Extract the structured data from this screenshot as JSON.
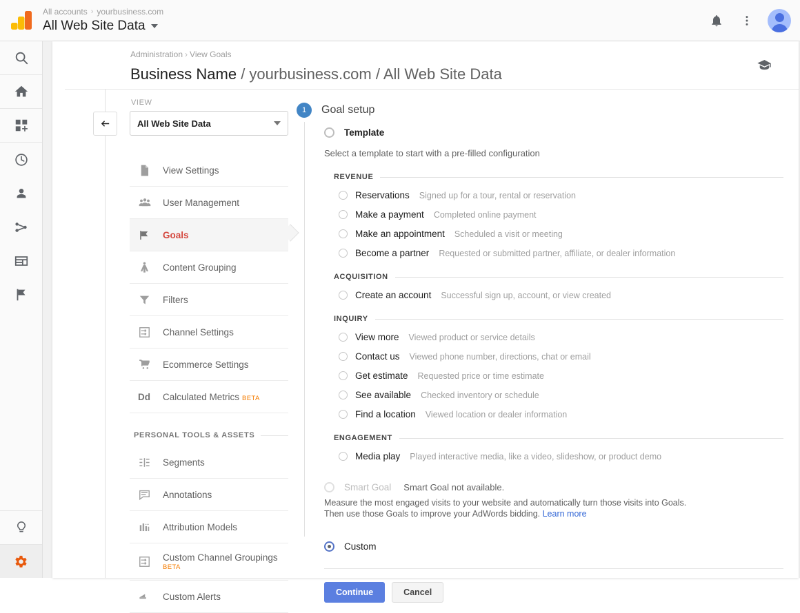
{
  "topbar": {
    "logo_icon": "google-analytics-logo",
    "breadcrumb": {
      "all_accounts": "All accounts",
      "separator": "›",
      "account": "yourbusiness.com"
    },
    "view_title": "All Web Site Data",
    "notifications_icon": "bell-icon",
    "more_icon": "more-vertical-icon",
    "avatar_icon": "user-avatar"
  },
  "rail": {
    "items": [
      {
        "name": "search-icon",
        "label": "Search"
      },
      {
        "name": "home-icon",
        "label": "Home"
      },
      {
        "name": "customization-icon",
        "label": "Customization"
      },
      {
        "name": "realtime-clock-icon",
        "label": "Realtime"
      },
      {
        "name": "audience-person-icon",
        "label": "Audience"
      },
      {
        "name": "acquisition-share-icon",
        "label": "Acquisition"
      },
      {
        "name": "behavior-window-icon",
        "label": "Behavior"
      },
      {
        "name": "conversions-flag-icon",
        "label": "Conversions"
      }
    ],
    "bottom_items": [
      {
        "name": "discover-bulb-icon",
        "label": "Discover"
      },
      {
        "name": "admin-gear-icon",
        "label": "Admin"
      }
    ]
  },
  "panel": {
    "breadcrumb": {
      "administration": "Administration",
      "separator": "›",
      "current": "View Goals"
    },
    "title_strong": "Business Name",
    "title_rest": " / yourbusiness.com / All Web Site Data",
    "academy_icon": "graduation-cap-icon"
  },
  "view_nav": {
    "collapse_icon": "arrow-left-icon",
    "view_label": "VIEW",
    "view_selected": "All Web Site Data",
    "items": [
      {
        "label": "View Settings",
        "icon": "document-icon",
        "active": false,
        "beta": ""
      },
      {
        "label": "User Management",
        "icon": "people-icon",
        "active": false,
        "beta": ""
      },
      {
        "label": "Goals",
        "icon": "flag-icon",
        "active": true,
        "beta": ""
      },
      {
        "label": "Content Grouping",
        "icon": "content-grouping-icon",
        "active": false,
        "beta": ""
      },
      {
        "label": "Filters",
        "icon": "filter-funnel-icon",
        "active": false,
        "beta": ""
      },
      {
        "label": "Channel Settings",
        "icon": "channel-settings-icon",
        "active": false,
        "beta": ""
      },
      {
        "label": "Ecommerce Settings",
        "icon": "shopping-cart-icon",
        "active": false,
        "beta": ""
      },
      {
        "label": "Calculated Metrics",
        "icon": "dd-icon",
        "active": false,
        "beta": "BETA"
      }
    ],
    "personal_section_title": "PERSONAL TOOLS & ASSETS",
    "personal_items": [
      {
        "label": "Segments",
        "icon": "segments-icon",
        "beta": ""
      },
      {
        "label": "Annotations",
        "icon": "annotations-icon",
        "beta": ""
      },
      {
        "label": "Attribution Models",
        "icon": "attribution-bars-icon",
        "beta": ""
      },
      {
        "label": "Custom Channel Groupings",
        "icon": "channel-settings-icon",
        "beta": "BETA"
      },
      {
        "label": "Custom Alerts",
        "icon": "custom-alerts-icon",
        "beta": ""
      }
    ]
  },
  "goal_setup": {
    "step_number": "1",
    "step_title": "Goal setup",
    "template_label": "Template",
    "template_helper": "Select a template to start with a pre-filled configuration",
    "groups": [
      {
        "title": "REVENUE",
        "options": [
          {
            "name": "Reservations",
            "desc": "Signed up for a tour, rental or reservation"
          },
          {
            "name": "Make a payment",
            "desc": "Completed online payment"
          },
          {
            "name": "Make an appointment",
            "desc": "Scheduled a visit or meeting"
          },
          {
            "name": "Become a partner",
            "desc": "Requested or submitted partner, affiliate, or dealer information"
          }
        ]
      },
      {
        "title": "ACQUISITION",
        "options": [
          {
            "name": "Create an account",
            "desc": "Successful sign up, account, or view created"
          }
        ]
      },
      {
        "title": "INQUIRY",
        "options": [
          {
            "name": "View more",
            "desc": "Viewed product or service details"
          },
          {
            "name": "Contact us",
            "desc": "Viewed phone number, directions, chat or email"
          },
          {
            "name": "Get estimate",
            "desc": "Requested price or time estimate"
          },
          {
            "name": "See available",
            "desc": "Checked inventory or schedule"
          },
          {
            "name": "Find a location",
            "desc": "Viewed location or dealer information"
          }
        ]
      },
      {
        "title": "ENGAGEMENT",
        "options": [
          {
            "name": "Media play",
            "desc": "Played interactive media, like a video, slideshow, or product demo"
          }
        ]
      }
    ],
    "smart_goal_label": "Smart Goal",
    "smart_goal_status": "Smart Goal not available.",
    "smart_goal_desc": "Measure the most engaged visits to your website and automatically turn those visits into Goals. Then use those Goals to improve your AdWords bidding. ",
    "smart_goal_link": "Learn more",
    "custom_label": "Custom",
    "continue_label": "Continue",
    "cancel_label": "Cancel"
  },
  "colors": {
    "accent_red": "#d5483f",
    "accent_blue": "#5b7fe0",
    "step_badge_blue": "#4285c5",
    "beta_orange": "#f57c00",
    "link_blue": "#3367d6",
    "admin_gear_orange": "#e8590c"
  }
}
